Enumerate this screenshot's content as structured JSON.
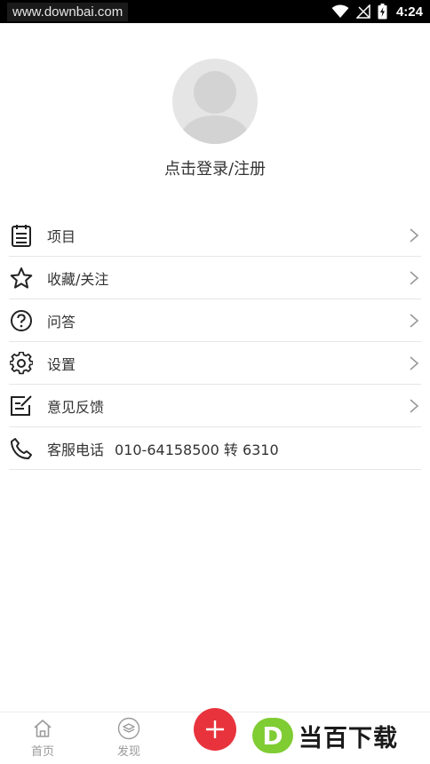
{
  "status_bar": {
    "watermark": "www.downbai.com",
    "time": "4:24"
  },
  "profile": {
    "login_label": "点击登录/注册"
  },
  "menu": {
    "items": [
      {
        "label": "项目",
        "icon": "clipboard-icon"
      },
      {
        "label": "收藏/关注",
        "icon": "star-icon"
      },
      {
        "label": "问答",
        "icon": "question-icon"
      },
      {
        "label": "设置",
        "icon": "gear-icon"
      },
      {
        "label": "意见反馈",
        "icon": "feedback-edit-icon"
      }
    ],
    "service": {
      "label": "客服电话",
      "value": "010-64158500 转 6310",
      "icon": "phone-icon"
    }
  },
  "bottom_nav": {
    "tabs": [
      {
        "label": "首页",
        "icon": "home-icon"
      },
      {
        "label": "发现",
        "icon": "layers-icon"
      }
    ],
    "fab_icon": "plus-icon"
  },
  "logo": {
    "mark": "D",
    "text": "当百下载"
  },
  "colors": {
    "accent": "#e8333c",
    "logo_green": "#7fcc33",
    "text": "#333333",
    "divider": "#e6e6e6"
  }
}
